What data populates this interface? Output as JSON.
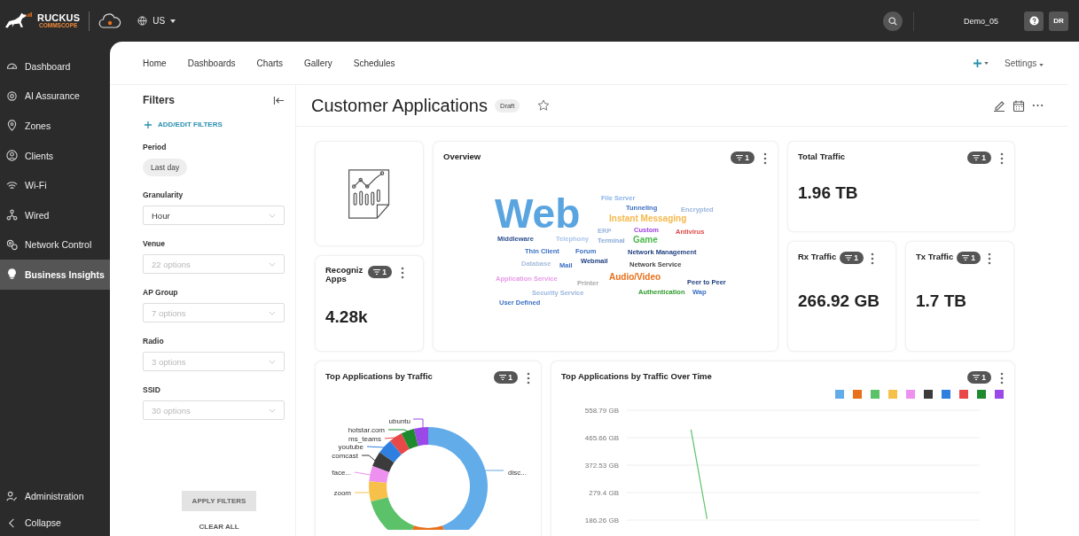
{
  "topbar": {
    "brand": "RUCKUS",
    "brand_sub": "COMMSCOPE",
    "region": "US",
    "user": "Demo_05",
    "avatar": "DR"
  },
  "sidebar": {
    "items": [
      {
        "label": "Dashboard",
        "selected": false
      },
      {
        "label": "AI Assurance",
        "selected": false
      },
      {
        "label": "Zones",
        "selected": false
      },
      {
        "label": "Clients",
        "selected": false
      },
      {
        "label": "Wi-Fi",
        "selected": false
      },
      {
        "label": "Wired",
        "selected": false
      },
      {
        "label": "Network Control",
        "selected": false
      },
      {
        "label": "Business Insights",
        "selected": true
      }
    ],
    "footer_items": [
      {
        "label": "Administration"
      },
      {
        "label": "Collapse"
      }
    ]
  },
  "nav": {
    "links": [
      "Home",
      "Dashboards",
      "Charts",
      "Gallery",
      "Schedules"
    ],
    "settings": "Settings"
  },
  "filters": {
    "title": "Filters",
    "add_link": "ADD/EDIT FILTERS",
    "period_label": "Period",
    "period_chip": "Last day",
    "fields": [
      {
        "label": "Granularity",
        "value": "Hour"
      },
      {
        "label": "Venue",
        "placeholder": "22 options"
      },
      {
        "label": "AP Group",
        "placeholder": "7 options"
      },
      {
        "label": "Radio",
        "placeholder": "3 options"
      },
      {
        "label": "SSID",
        "placeholder": "30 options"
      }
    ],
    "apply": "APPLY FILTERS",
    "clear": "CLEAR ALL"
  },
  "page": {
    "title": "Customer Applications",
    "badge": "Draft",
    "starred": false
  },
  "widgets": {
    "recognized": {
      "title_lines": [
        "Recogniz",
        "Apps"
      ],
      "filter_count": "1",
      "value": "4.28k"
    },
    "overview": {
      "title": "Overview",
      "filter_count": "1",
      "words": [
        {
          "text": "File Server",
          "color": "#8ab4e8",
          "kind": "small"
        },
        {
          "text": "Tunneling",
          "color": "#3a6fc4",
          "kind": "small"
        },
        {
          "text": "Encrypted",
          "color": "#9ab6de",
          "kind": "small"
        },
        {
          "text": "Instant Messaging",
          "color": "#f5b84a",
          "kind": "medium"
        },
        {
          "text": "Web",
          "color": "#5aa5e0",
          "kind": "large"
        },
        {
          "text": "ERP",
          "color": "#9ab6de",
          "kind": "small"
        },
        {
          "text": "Custom",
          "color": "#a040e0",
          "kind": "small"
        },
        {
          "text": "Antivirus",
          "color": "#e04848",
          "kind": "small"
        },
        {
          "text": "Middleware",
          "color": "#2f4f8f",
          "kind": "small"
        },
        {
          "text": "Telephony",
          "color": "#a8c4ec",
          "kind": "small"
        },
        {
          "text": "Terminal",
          "color": "#8aa8d8",
          "kind": "small"
        },
        {
          "text": "Game",
          "color": "#4cb84c",
          "kind": "medium"
        },
        {
          "text": "Thin Client",
          "color": "#3a6fc4",
          "kind": "small"
        },
        {
          "text": "Forum",
          "color": "#3a6fc4",
          "kind": "small"
        },
        {
          "text": "Network Management",
          "color": "#1f3f7f",
          "kind": "small"
        },
        {
          "text": "Database",
          "color": "#a8bcdc",
          "kind": "small"
        },
        {
          "text": "Mail",
          "color": "#3a6fc4",
          "kind": "small"
        },
        {
          "text": "Webmail",
          "color": "#1f3f7f",
          "kind": "small"
        },
        {
          "text": "Network Service",
          "color": "#444444",
          "kind": "small"
        },
        {
          "text": "Application Service",
          "color": "#e89ae8",
          "kind": "small"
        },
        {
          "text": "Printer",
          "color": "#a8a8a8",
          "kind": "small"
        },
        {
          "text": "Audio/Video",
          "color": "#e8701a",
          "kind": "medium"
        },
        {
          "text": "Peer to Peer",
          "color": "#1f3f7f",
          "kind": "small"
        },
        {
          "text": "Security Service",
          "color": "#9ab6de",
          "kind": "small"
        },
        {
          "text": "Authentication",
          "color": "#2e9a2e",
          "kind": "small"
        },
        {
          "text": "Wap",
          "color": "#3a6fc4",
          "kind": "small"
        },
        {
          "text": "User Defined",
          "color": "#3a6fc4",
          "kind": "small"
        }
      ]
    },
    "total": {
      "title": "Total Traffic",
      "filter_count": "1",
      "value": "1.96 TB"
    },
    "rx": {
      "title": "Rx Traffic",
      "filter_count": "1",
      "value": "266.92 GB"
    },
    "tx": {
      "title": "Tx Traffic",
      "filter_count": "1",
      "value": "1.7 TB"
    },
    "top_apps": {
      "title": "Top Applications by Traffic",
      "filter_count": "1",
      "slices": [
        {
          "label": "ubuntu",
          "color": "#9a48e8"
        },
        {
          "label": "hotstar.com",
          "color": "#1e8a2e"
        },
        {
          "label": "ms_teams",
          "color": "#e84848"
        },
        {
          "label": "youtube",
          "color": "#2f7fe0"
        },
        {
          "label": "comcast",
          "color": "#3b3b3b"
        },
        {
          "label": "face...",
          "color": "#ee90f0"
        },
        {
          "label": "zoom",
          "color": "#f7c04a"
        },
        {
          "color": "#5cc26a"
        },
        {
          "color": "#e8701a"
        },
        {
          "label": "disc...",
          "color": "#62acea"
        }
      ]
    },
    "over_time": {
      "title": "Top Applications by Traffic Over Time",
      "filter_count": "1",
      "legend": [
        {
          "color": "#62acea"
        },
        {
          "color": "#e8701a"
        },
        {
          "color": "#5cc26a"
        },
        {
          "color": "#f7c04a"
        },
        {
          "color": "#ee90f0"
        },
        {
          "color": "#3b3b3b"
        },
        {
          "color": "#2f7fe0"
        },
        {
          "color": "#e84848"
        },
        {
          "color": "#1e8a2e"
        },
        {
          "color": "#9a48e8"
        }
      ],
      "chart_data": {
        "type": "line",
        "grid": true,
        "ylim": [
          186.26,
          558.79
        ],
        "categories": [
          null,
          null,
          null,
          null,
          null,
          null,
          null,
          null,
          null,
          null,
          null,
          null,
          null,
          null,
          null,
          null,
          null,
          null,
          null,
          null,
          null,
          null,
          null
        ],
        "yticks": [
          {
            "value": 558.79,
            "label": "558.79 GB"
          },
          {
            "value": 465.66,
            "label": "465.66 GB"
          },
          {
            "value": 372.53,
            "label": "372.53 GB"
          },
          {
            "value": 279.4,
            "label": "279.4 GB"
          },
          {
            "value": 186.26,
            "label": "186.26 GB"
          }
        ],
        "series": [
          {
            "color": "#5cc26a",
            "values": [
              null,
              null,
              null,
              null,
              493,
              190,
              null,
              null,
              null,
              null,
              null,
              null,
              null,
              null,
              null,
              null,
              null,
              null,
              null,
              null,
              null,
              null,
              null
            ]
          }
        ]
      }
    }
  }
}
